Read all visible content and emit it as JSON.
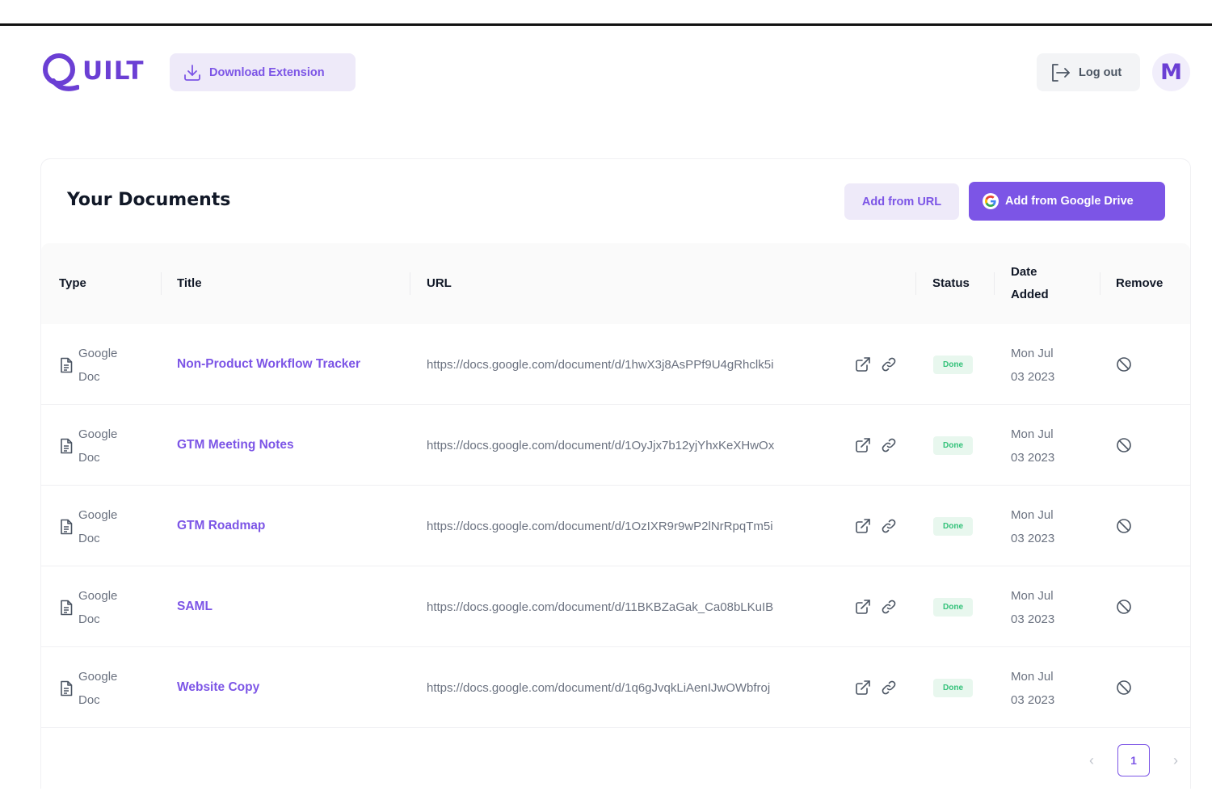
{
  "header": {
    "logo_text": "UILT",
    "download_label": "Download Extension",
    "logout_label": "Log out",
    "avatar_initial": "M"
  },
  "documents": {
    "title": "Your Documents",
    "add_url_label": "Add from URL",
    "add_drive_label": "Add from Google Drive",
    "columns": {
      "type": "Type",
      "title": "Title",
      "url": "URL",
      "status": "Status",
      "date_line1": "Date",
      "date_line2": "Added",
      "remove": "Remove"
    },
    "rows": [
      {
        "type_line1": "Google",
        "type_line2": "Doc",
        "title": "Non-Product Workflow Tracker",
        "url": "https://docs.google.com/document/d/1hwX3j8AsPPf9U4gRhclk5i",
        "status": "Done",
        "date_line1": "Mon Jul",
        "date_line2": "03 2023"
      },
      {
        "type_line1": "Google",
        "type_line2": "Doc",
        "title": "GTM Meeting Notes",
        "url": "https://docs.google.com/document/d/1OyJjx7b12yjYhxKeXHwOx",
        "status": "Done",
        "date_line1": "Mon Jul",
        "date_line2": "03 2023"
      },
      {
        "type_line1": "Google",
        "type_line2": "Doc",
        "title": "GTM Roadmap",
        "url": "https://docs.google.com/document/d/1OzIXR9r9wP2lNrRpqTm5i",
        "status": "Done",
        "date_line1": "Mon Jul",
        "date_line2": "03 2023"
      },
      {
        "type_line1": "Google",
        "type_line2": "Doc",
        "title": "SAML",
        "url": "https://docs.google.com/document/d/11BKBZaGak_Ca08bLKuIB",
        "status": "Done",
        "date_line1": "Mon Jul",
        "date_line2": "03 2023"
      },
      {
        "type_line1": "Google",
        "type_line2": "Doc",
        "title": "Website Copy",
        "url": "https://docs.google.com/document/d/1q6gJvqkLiAenIJwOWbfroj",
        "status": "Done",
        "date_line1": "Mon Jul",
        "date_line2": "03 2023"
      }
    ]
  },
  "pagination": {
    "prev": "‹",
    "current": "1",
    "next": "›"
  },
  "colors": {
    "accent": "#7c55e6",
    "accent_light": "#eeeaf9",
    "status_done_bg": "#e8f7ee",
    "status_done_text": "#34c27a"
  },
  "icons": {
    "download": "download-icon",
    "logout": "logout-icon",
    "google": "google-icon",
    "document": "document-icon",
    "external_link": "external-link-icon",
    "copy_link": "link-icon",
    "remove": "block-icon"
  }
}
